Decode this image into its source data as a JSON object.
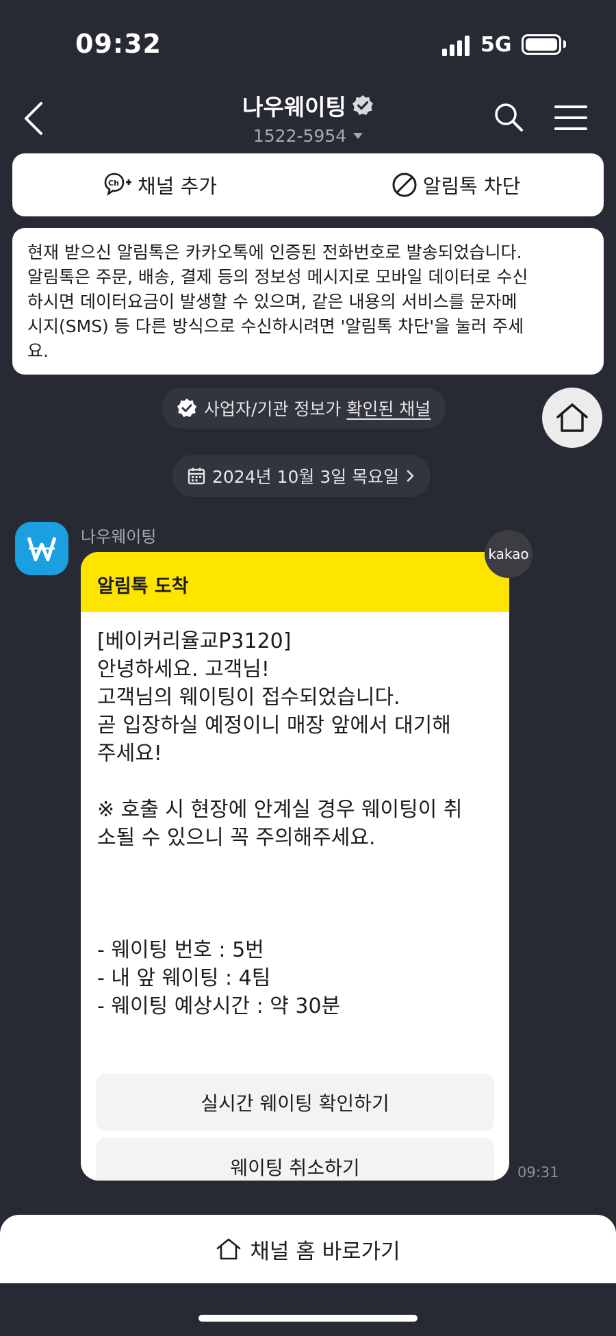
{
  "status_bar": {
    "time": "09:32",
    "network": "5G",
    "icons": [
      "signal-icon",
      "battery-icon"
    ]
  },
  "header": {
    "title": "나우웨이팅",
    "phone": "1522-5954",
    "icons": [
      "back-icon",
      "verified-icon",
      "search-icon",
      "menu-icon"
    ]
  },
  "channel_actions": {
    "add_label": "채널 추가",
    "block_label": "알림톡 차단",
    "icons": [
      "channel-add-icon",
      "block-icon"
    ]
  },
  "notice": {
    "lines": [
      "현재 받으신 알림톡은 카카오톡에 인증된 전화번호로 발송되었습니다.",
      "알림톡은 주문, 배송, 결제 등의 정보성 메시지로 모바일 데이터로 수신",
      "하시면 데이터요금이 발생할 수 있으며, 같은 내용의 서비스를 문자메",
      "시지(SMS) 등 다른 방식으로 수신하시려면 '알림톡 차단'을 눌러 주세",
      "요."
    ]
  },
  "verified_channel": {
    "prefix": "사업자/기관 정보가 ",
    "link": "확인된 채널"
  },
  "date_divider": {
    "label": "2024년 10월 3일 목요일",
    "icons": [
      "calendar-icon",
      "chevron-right-icon"
    ]
  },
  "message": {
    "sender": "나우웨이팅",
    "badge": "kakao",
    "header": "알림톡 도착",
    "body": "[베이커리율교P3120]\n안녕하세요. 고객님!\n고객님의 웨이팅이 접수되었습니다.\n곧 입장하실 예정이니 매장 앞에서 대기해\n주세요!\n\n※ 호출 시 현장에 안계실 경우 웨이팅이 취\n소될 수 있으니 꼭 주의해주세요.\n\n\n\n- 웨이팅 번호 : 5번\n- 내 앞 웨이팅 : 4팀\n- 웨이팅 예상시간 : 약 30분",
    "buttons": [
      "실시간 웨이팅 확인하기",
      "웨이팅 취소하기"
    ],
    "time": "09:31"
  },
  "bottom": {
    "home_link": "채널 홈 바로가기",
    "icons": [
      "home-icon"
    ]
  },
  "colors": {
    "background": "#282a33",
    "card": "#ffffff",
    "bubble_header": "#fde500",
    "avatar": "#1a9fe0"
  }
}
